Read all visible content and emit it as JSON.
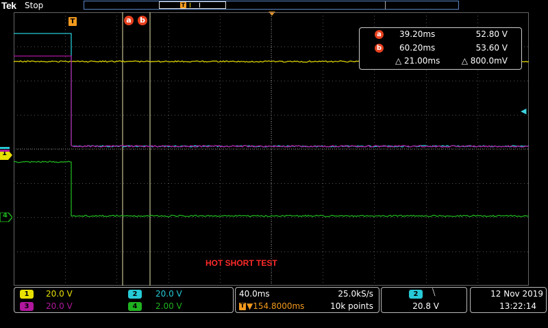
{
  "header": {
    "brand": "Tek",
    "acq_state": "Stop",
    "trigger_label": "T"
  },
  "cursors": {
    "a_label": "a",
    "b_label": "b"
  },
  "readout": {
    "a": {
      "label": "a",
      "time": "39.20ms",
      "volt": "52.80 V"
    },
    "b": {
      "label": "b",
      "time": "60.20ms",
      "volt": "53.60 V"
    },
    "delta": {
      "time": "△ 21.00ms",
      "volt": "△ 800.0mV"
    }
  },
  "markers": {
    "ch1": "1",
    "ch4": "4"
  },
  "annotation": "HOT SHORT  TEST",
  "channels": [
    {
      "num": "1",
      "scale": "20.0 V",
      "color": "#e8e000"
    },
    {
      "num": "2",
      "scale": "20.0 V",
      "color": "#26c9d6"
    },
    {
      "num": "3",
      "scale": "20.0 V",
      "color": "#b0179c"
    },
    {
      "num": "4",
      "scale": "2.00 V",
      "color": "#1fb21f"
    }
  ],
  "horizontal": {
    "timebase": "40.0ms",
    "sample_rate": "25.0kS/s",
    "trigger_position": "▼154.8000ms",
    "record_length": "10k points"
  },
  "trigger": {
    "source": "2",
    "slope_icon": "falling-edge-icon",
    "slope_glyph": "⧹",
    "level": "20.8 V"
  },
  "datetime": {
    "date": "12 Nov 2019",
    "time": "13:22:14"
  },
  "colors": {
    "ch1": "#e8e000",
    "ch2": "#26c9d6",
    "ch3": "#b0179c",
    "ch4": "#1fb21f",
    "trigger": "#f39a1e",
    "cursor": "#e8401e",
    "grid": "#555555"
  }
}
